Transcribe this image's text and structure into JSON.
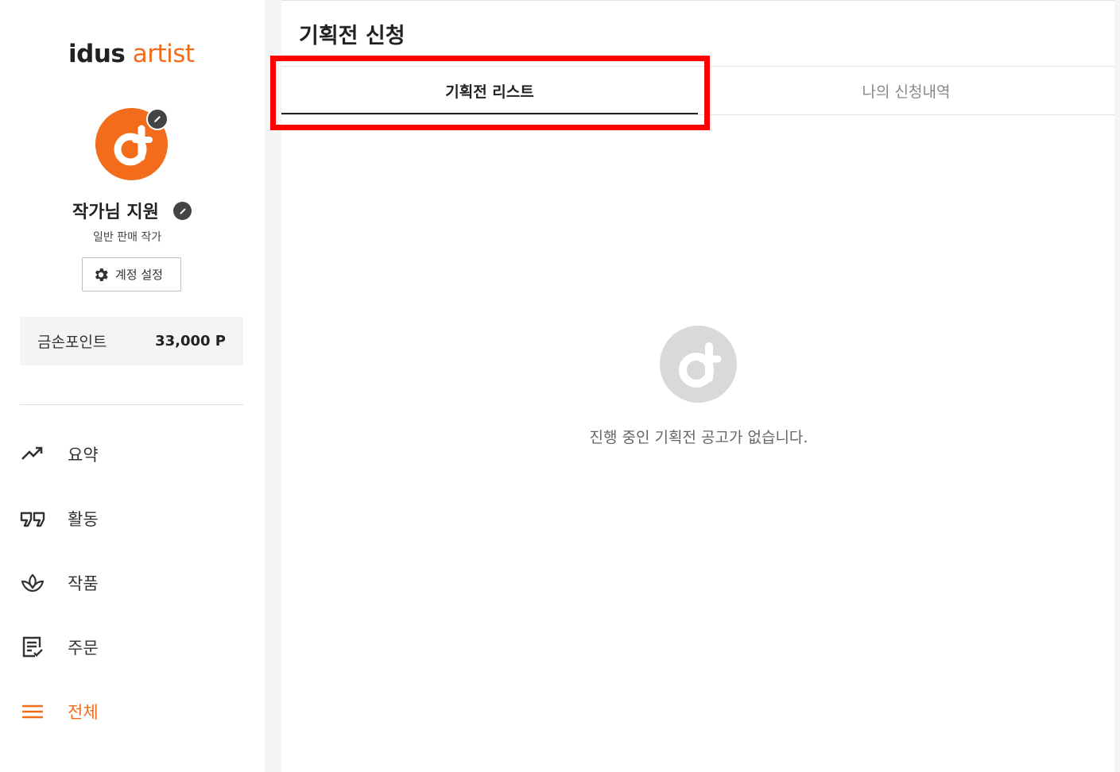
{
  "logo": {
    "part1": "idus",
    "part2": " artist"
  },
  "profile": {
    "name": "작가님 지원",
    "type": "일반 판매 작가",
    "account_settings_label": "계정 설정"
  },
  "points": {
    "label": "금손포인트",
    "value": "33,000 P"
  },
  "nav": [
    {
      "label": "요약",
      "icon": "trending-up-icon"
    },
    {
      "label": "활동",
      "icon": "quote-icon"
    },
    {
      "label": "작품",
      "icon": "plant-icon"
    },
    {
      "label": "주문",
      "icon": "order-list-icon"
    },
    {
      "label": "전체",
      "icon": "menu-icon",
      "active": true
    }
  ],
  "main": {
    "title": "기획전 신청",
    "tabs": [
      {
        "label": "기획전 리스트",
        "active": true
      },
      {
        "label": "나의 신청내역",
        "active": false
      }
    ],
    "empty_message": "진행 중인 기획전 공고가 없습니다."
  },
  "colors": {
    "brand": "#f26c1c",
    "highlight": "#ff0000",
    "empty_icon": "#d9d9d9"
  }
}
